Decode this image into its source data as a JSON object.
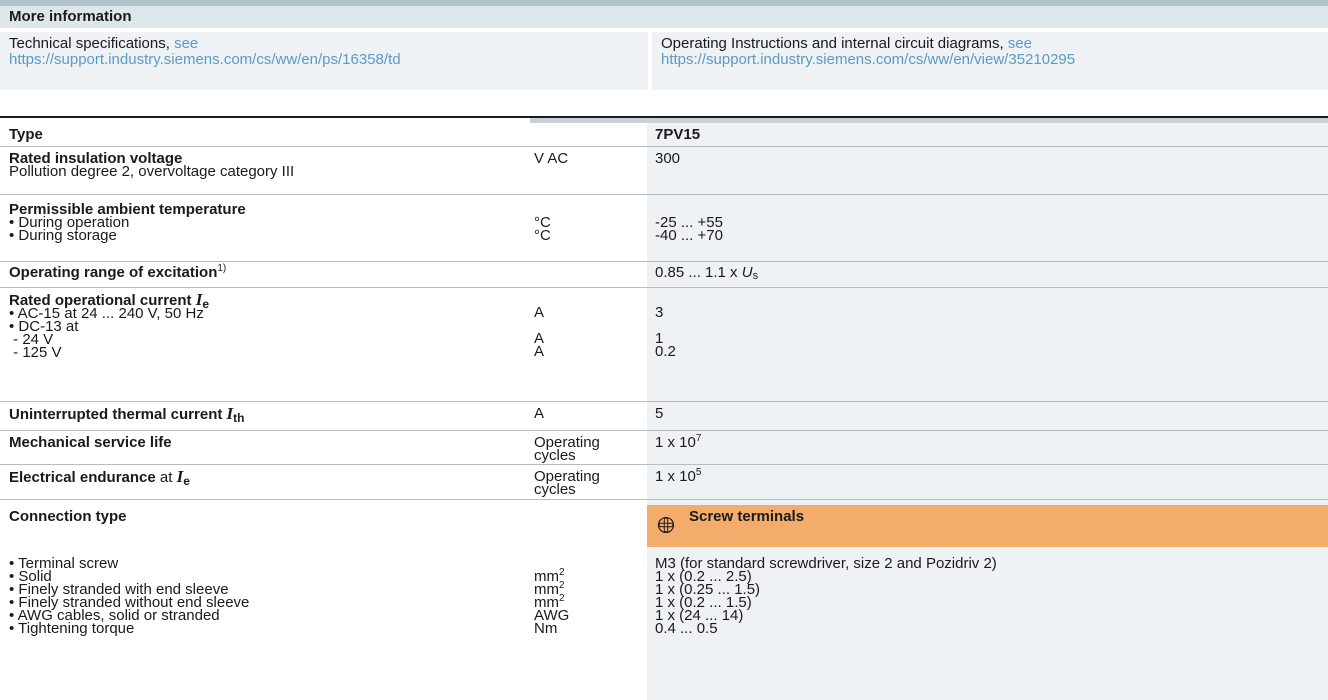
{
  "more_info": {
    "heading": "More information",
    "left_text": "Technical specifications, ",
    "left_see": "see",
    "left_link": "https://support.industry.siemens.com/cs/ww/en/ps/16358/td",
    "right_text": "Operating Instructions and internal circuit diagrams, ",
    "right_see": "see",
    "right_link": "https://support.industry.siemens.com/cs/ww/en/view/35210295"
  },
  "table": {
    "type_label": "Type",
    "type_value": "7PV15",
    "rated_insulation": {
      "label": "Rated insulation voltage",
      "sublabel": "Pollution degree 2, overvoltage category III",
      "unit": "V AC",
      "value": "300"
    },
    "ambient_temp": {
      "label": "Permissible ambient temperature",
      "operation": "• During operation",
      "operation_unit": "°C",
      "operation_value": "-25 ... +55",
      "storage": "• During storage",
      "storage_unit": "°C",
      "storage_value": "-40 ... +70"
    },
    "excitation": {
      "label": "Operating range of excitation",
      "footnote": "1)",
      "value_prefix": "0.85 ... 1.1 x ",
      "value_symbol": "U",
      "value_sub": "s"
    },
    "rated_current": {
      "label": "Rated operational current ",
      "symbol": "I",
      "symbol_sub": "e",
      "ac15": "• AC-15 at 24 ... 240 V, 50 Hz",
      "ac15_unit": "A",
      "ac15_value": "3",
      "dc13": "• DC-13 at",
      "v24": "- 24 V",
      "v24_unit": "A",
      "v24_value": "1",
      "v125": "- 125 V",
      "v125_unit": "A",
      "v125_value": "0.2"
    },
    "thermal_current": {
      "label": "Uninterrupted thermal current ",
      "symbol": "I",
      "symbol_sub": "th",
      "unit": "A",
      "value": "5"
    },
    "mech_life": {
      "label": "Mechanical service life",
      "unit_line1": "Operating",
      "unit_line2": "cycles",
      "value_base": "1 x 10",
      "value_exp": "7"
    },
    "elec_endurance": {
      "label": "Electrical endurance",
      "label_rest": " at ",
      "symbol": "I",
      "symbol_sub": "e",
      "unit_line1": "Operating",
      "unit_line2": "cycles",
      "value_base": "1 x 10",
      "value_exp": "5"
    },
    "connection": {
      "label": "Connection type",
      "header": "Screw terminals",
      "accent_color": "#f3ac6b",
      "icon": "screw-terminal-icon",
      "terminal_screw": "• Terminal screw",
      "terminal_screw_value": "M3 (for standard screwdriver, size 2 and Pozidriv 2)",
      "solid": "• Solid",
      "solid_unit_base": "mm",
      "solid_unit_exp": "2",
      "solid_value": "1 x (0.2 ... 2.5)",
      "fine_sleeve": "• Finely stranded with end sleeve",
      "fine_sleeve_unit_base": "mm",
      "fine_sleeve_unit_exp": "2",
      "fine_sleeve_value": "1 x (0.25 ... 1.5)",
      "fine_nosleeve": "• Finely stranded without end sleeve",
      "fine_nosleeve_unit_base": "mm",
      "fine_nosleeve_unit_exp": "2",
      "fine_nosleeve_value": "1 x (0.2 ... 1.5)",
      "awg": "• AWG cables, solid or stranded",
      "awg_unit": "AWG",
      "awg_value": "1 x (24 ... 14)",
      "torque": "• Tightening torque",
      "torque_unit": "Nm",
      "torque_value": "0.4 ... 0.5"
    }
  }
}
